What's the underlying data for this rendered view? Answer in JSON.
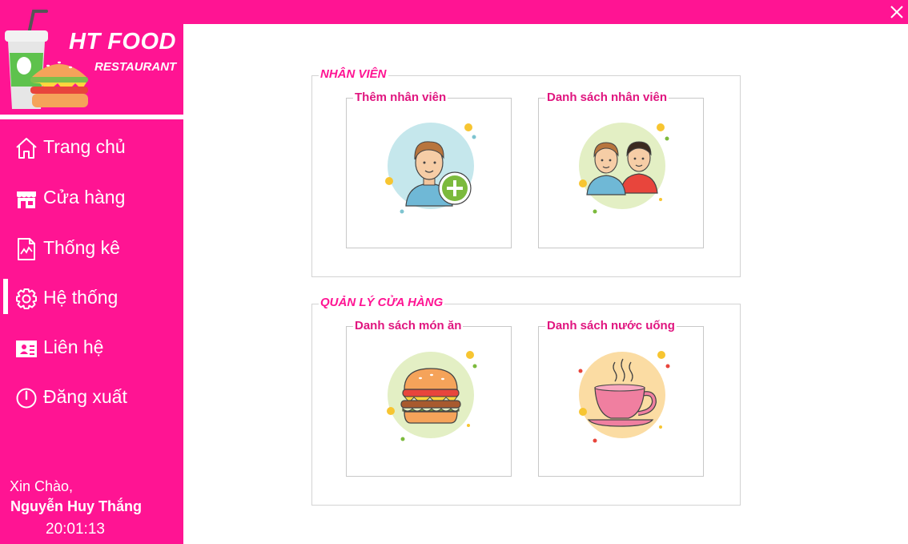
{
  "window": {
    "close_icon": "close-icon"
  },
  "brand": {
    "title": "HT FOOD",
    "subtitle": "RESTAURANT",
    "logo_icon": "soda-and-burger-icon"
  },
  "nav": {
    "items": [
      {
        "label": "Trang chủ",
        "icon": "home-icon",
        "active": false
      },
      {
        "label": "Cửa hàng",
        "icon": "store-icon",
        "active": false
      },
      {
        "label": "Thống kê",
        "icon": "chart-file-icon",
        "active": false
      },
      {
        "label": "Hệ thống",
        "icon": "gear-icon",
        "active": true
      },
      {
        "label": "Liên hệ",
        "icon": "contact-card-icon",
        "active": false
      },
      {
        "label": "Đăng xuất",
        "icon": "power-icon",
        "active": false
      }
    ]
  },
  "user": {
    "greeting": "Xin Chào,",
    "name": "Nguyễn Huy Thắng",
    "time": "20:01:13"
  },
  "groups": [
    {
      "title": "NHÂN VIÊN",
      "tiles": [
        {
          "title": "Thêm nhân viên",
          "icon": "add-employee-icon"
        },
        {
          "title": "Danh sách nhân viên",
          "icon": "employee-list-icon"
        }
      ]
    },
    {
      "title": "QUẢN LÝ CỬA HÀNG",
      "tiles": [
        {
          "title": "Danh sách món ăn",
          "icon": "burger-icon"
        },
        {
          "title": "Danh sách nước uống",
          "icon": "coffee-cup-icon"
        }
      ]
    }
  ],
  "colors": {
    "accent": "#ff1493",
    "tile_title": "#e0157f",
    "border": "#d3d3d3"
  }
}
